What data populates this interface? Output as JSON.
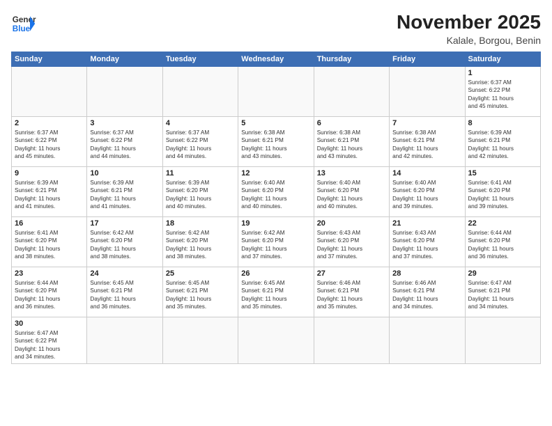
{
  "header": {
    "logo_general": "General",
    "logo_blue": "Blue",
    "month_year": "November 2025",
    "location": "Kalale, Borgou, Benin"
  },
  "weekdays": [
    "Sunday",
    "Monday",
    "Tuesday",
    "Wednesday",
    "Thursday",
    "Friday",
    "Saturday"
  ],
  "weeks": [
    [
      {
        "day": "",
        "info": ""
      },
      {
        "day": "",
        "info": ""
      },
      {
        "day": "",
        "info": ""
      },
      {
        "day": "",
        "info": ""
      },
      {
        "day": "",
        "info": ""
      },
      {
        "day": "",
        "info": ""
      },
      {
        "day": "1",
        "info": "Sunrise: 6:37 AM\nSunset: 6:22 PM\nDaylight: 11 hours\nand 45 minutes."
      }
    ],
    [
      {
        "day": "2",
        "info": "Sunrise: 6:37 AM\nSunset: 6:22 PM\nDaylight: 11 hours\nand 45 minutes."
      },
      {
        "day": "3",
        "info": "Sunrise: 6:37 AM\nSunset: 6:22 PM\nDaylight: 11 hours\nand 44 minutes."
      },
      {
        "day": "4",
        "info": "Sunrise: 6:37 AM\nSunset: 6:22 PM\nDaylight: 11 hours\nand 44 minutes."
      },
      {
        "day": "5",
        "info": "Sunrise: 6:38 AM\nSunset: 6:21 PM\nDaylight: 11 hours\nand 43 minutes."
      },
      {
        "day": "6",
        "info": "Sunrise: 6:38 AM\nSunset: 6:21 PM\nDaylight: 11 hours\nand 43 minutes."
      },
      {
        "day": "7",
        "info": "Sunrise: 6:38 AM\nSunset: 6:21 PM\nDaylight: 11 hours\nand 42 minutes."
      },
      {
        "day": "8",
        "info": "Sunrise: 6:39 AM\nSunset: 6:21 PM\nDaylight: 11 hours\nand 42 minutes."
      }
    ],
    [
      {
        "day": "9",
        "info": "Sunrise: 6:39 AM\nSunset: 6:21 PM\nDaylight: 11 hours\nand 41 minutes."
      },
      {
        "day": "10",
        "info": "Sunrise: 6:39 AM\nSunset: 6:21 PM\nDaylight: 11 hours\nand 41 minutes."
      },
      {
        "day": "11",
        "info": "Sunrise: 6:39 AM\nSunset: 6:20 PM\nDaylight: 11 hours\nand 40 minutes."
      },
      {
        "day": "12",
        "info": "Sunrise: 6:40 AM\nSunset: 6:20 PM\nDaylight: 11 hours\nand 40 minutes."
      },
      {
        "day": "13",
        "info": "Sunrise: 6:40 AM\nSunset: 6:20 PM\nDaylight: 11 hours\nand 40 minutes."
      },
      {
        "day": "14",
        "info": "Sunrise: 6:40 AM\nSunset: 6:20 PM\nDaylight: 11 hours\nand 39 minutes."
      },
      {
        "day": "15",
        "info": "Sunrise: 6:41 AM\nSunset: 6:20 PM\nDaylight: 11 hours\nand 39 minutes."
      }
    ],
    [
      {
        "day": "16",
        "info": "Sunrise: 6:41 AM\nSunset: 6:20 PM\nDaylight: 11 hours\nand 38 minutes."
      },
      {
        "day": "17",
        "info": "Sunrise: 6:42 AM\nSunset: 6:20 PM\nDaylight: 11 hours\nand 38 minutes."
      },
      {
        "day": "18",
        "info": "Sunrise: 6:42 AM\nSunset: 6:20 PM\nDaylight: 11 hours\nand 38 minutes."
      },
      {
        "day": "19",
        "info": "Sunrise: 6:42 AM\nSunset: 6:20 PM\nDaylight: 11 hours\nand 37 minutes."
      },
      {
        "day": "20",
        "info": "Sunrise: 6:43 AM\nSunset: 6:20 PM\nDaylight: 11 hours\nand 37 minutes."
      },
      {
        "day": "21",
        "info": "Sunrise: 6:43 AM\nSunset: 6:20 PM\nDaylight: 11 hours\nand 37 minutes."
      },
      {
        "day": "22",
        "info": "Sunrise: 6:44 AM\nSunset: 6:20 PM\nDaylight: 11 hours\nand 36 minutes."
      }
    ],
    [
      {
        "day": "23",
        "info": "Sunrise: 6:44 AM\nSunset: 6:20 PM\nDaylight: 11 hours\nand 36 minutes."
      },
      {
        "day": "24",
        "info": "Sunrise: 6:45 AM\nSunset: 6:21 PM\nDaylight: 11 hours\nand 36 minutes."
      },
      {
        "day": "25",
        "info": "Sunrise: 6:45 AM\nSunset: 6:21 PM\nDaylight: 11 hours\nand 35 minutes."
      },
      {
        "day": "26",
        "info": "Sunrise: 6:45 AM\nSunset: 6:21 PM\nDaylight: 11 hours\nand 35 minutes."
      },
      {
        "day": "27",
        "info": "Sunrise: 6:46 AM\nSunset: 6:21 PM\nDaylight: 11 hours\nand 35 minutes."
      },
      {
        "day": "28",
        "info": "Sunrise: 6:46 AM\nSunset: 6:21 PM\nDaylight: 11 hours\nand 34 minutes."
      },
      {
        "day": "29",
        "info": "Sunrise: 6:47 AM\nSunset: 6:21 PM\nDaylight: 11 hours\nand 34 minutes."
      }
    ],
    [
      {
        "day": "30",
        "info": "Sunrise: 6:47 AM\nSunset: 6:22 PM\nDaylight: 11 hours\nand 34 minutes."
      },
      {
        "day": "",
        "info": ""
      },
      {
        "day": "",
        "info": ""
      },
      {
        "day": "",
        "info": ""
      },
      {
        "day": "",
        "info": ""
      },
      {
        "day": "",
        "info": ""
      },
      {
        "day": "",
        "info": ""
      }
    ]
  ]
}
